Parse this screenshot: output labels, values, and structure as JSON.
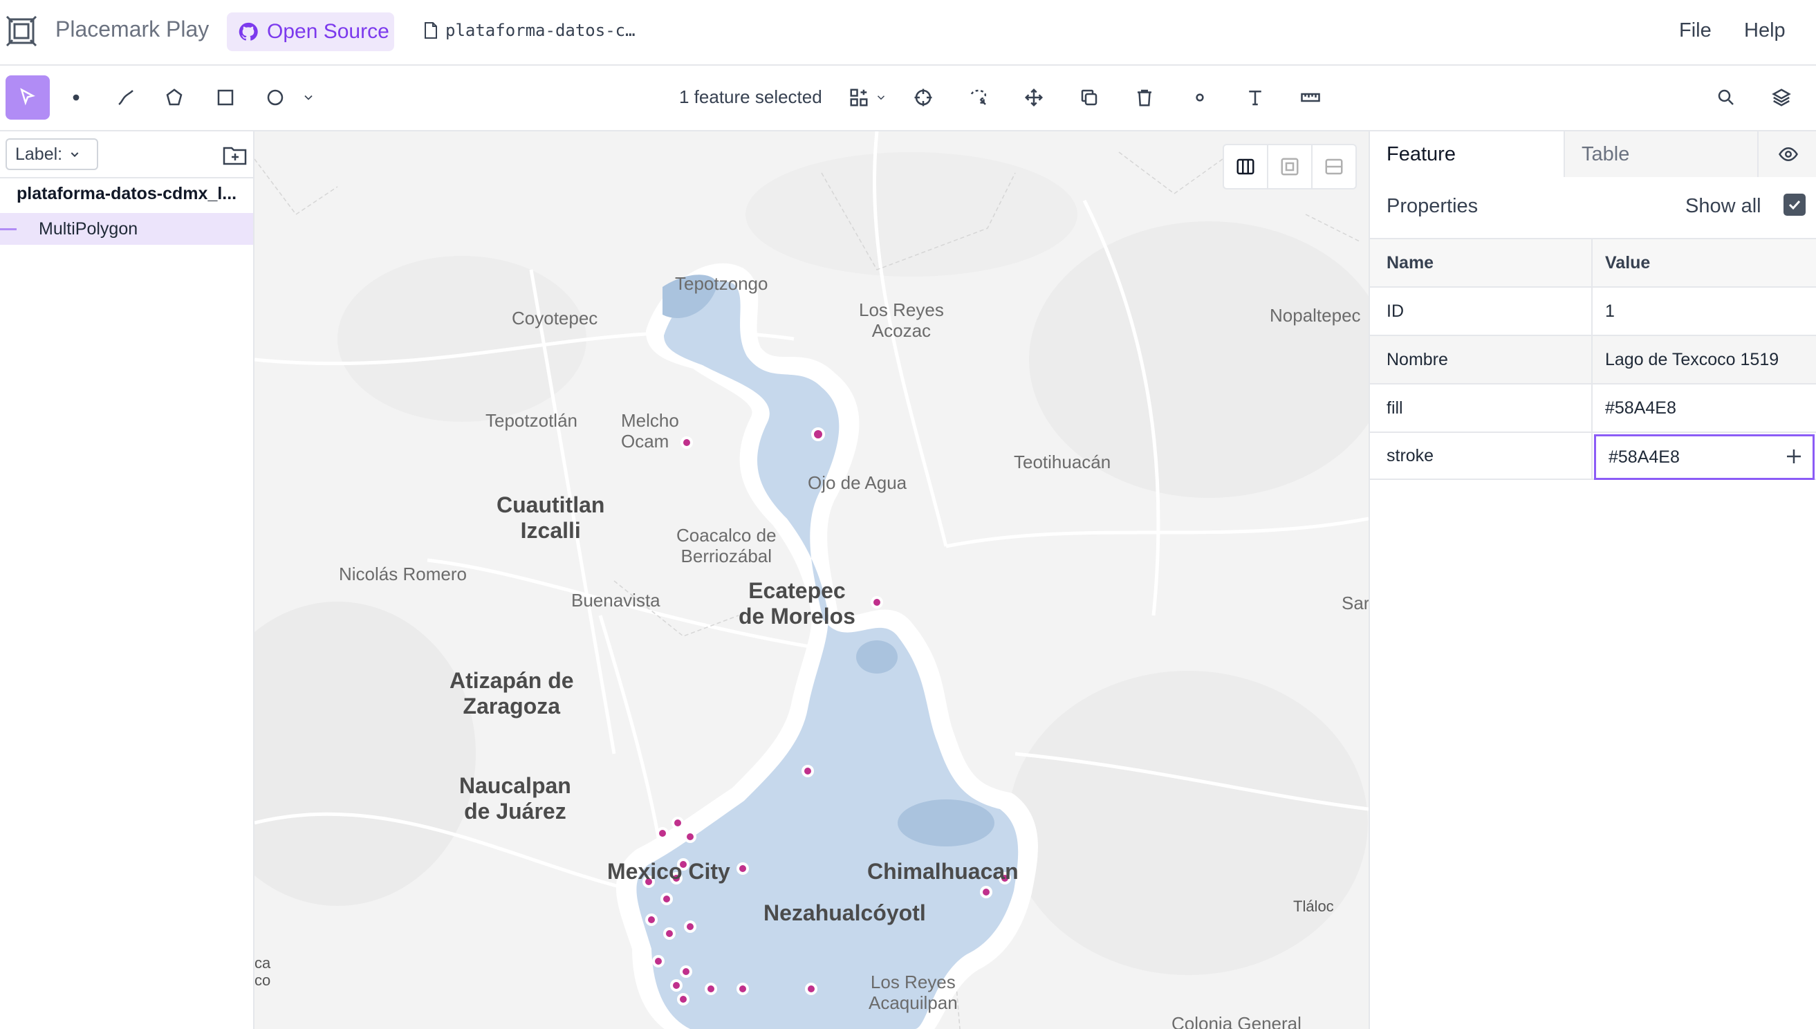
{
  "header": {
    "app_title": "Placemark Play",
    "badge_label": "Open Source",
    "file_name": "plataforma-datos-c…",
    "menu": [
      "File",
      "Help"
    ]
  },
  "toolbar": {
    "selection_status": "1 feature selected",
    "tools": [
      "select-icon",
      "point-icon",
      "line-icon",
      "polygon-icon",
      "rectangle-icon",
      "circle-icon",
      "chevron-down-icon",
      "group-icon",
      "crosshair-icon",
      "lasso-icon",
      "move-icon",
      "copy-icon",
      "trash-icon",
      "vertex-icon",
      "text-icon",
      "ruler-icon",
      "search-icon",
      "layers-icon"
    ]
  },
  "left_panel": {
    "label_dropdown": "Label:",
    "file_entry": "plataforma-datos-cdmx_l...",
    "layers": [
      {
        "label": "MultiPolygon"
      }
    ]
  },
  "map": {
    "places": [
      "Coyotepec",
      "Los Reyes",
      "Acozac",
      "Nopaltepec",
      "Tepotzotlán",
      "Melcho",
      "Ocam",
      "Teotihuacán",
      "Cuautitlan",
      "Izcalli",
      "Coacalco de",
      "Berriozábal",
      "Ojo de Agua",
      "Nicolás Romero",
      "Buenavista",
      "Ecatepec",
      "de Morelos",
      "Sar",
      "Atizapán de",
      "Zaragoza",
      "Naucalpan",
      "de Juárez",
      "Mexico City",
      "Chimalhuacan",
      "Nezahualcóyotl",
      "Tláloc",
      "Los Reyes",
      "Acaquilpan",
      "Colonia General",
      "ca",
      "co",
      "Tepotzongo"
    ],
    "polygon_color": "#58A4E8"
  },
  "right_panel": {
    "tabs": [
      "Feature",
      "Table"
    ],
    "properties_title": "Properties",
    "show_all_label": "Show all",
    "show_all_checked": true,
    "table_headers": {
      "name": "Name",
      "value": "Value"
    },
    "rows": [
      {
        "name": "ID",
        "value": "1"
      },
      {
        "name": "Nombre",
        "value": "Lago de Texcoco 1519"
      },
      {
        "name": "fill",
        "value": "#58A4E8"
      },
      {
        "name": "stroke",
        "value": "#58A4E8"
      }
    ]
  },
  "colors": {
    "accent": "#b18cf5",
    "badge_bg": "#efe8fb",
    "badge_text": "#7c3aed",
    "polygon_fill": "#58A4E8",
    "vertex": "#c0308c"
  }
}
